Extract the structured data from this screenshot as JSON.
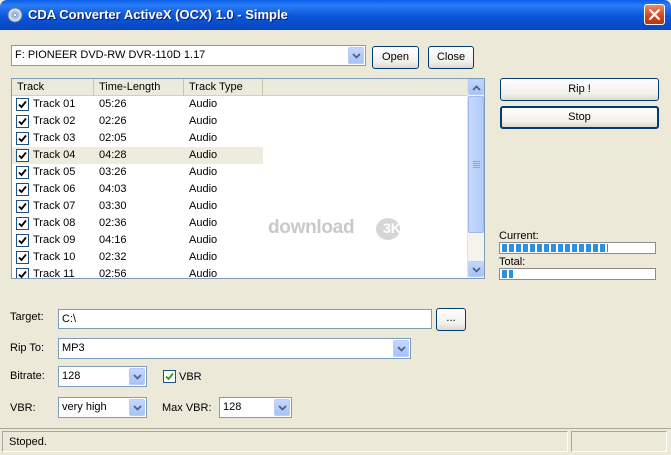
{
  "window": {
    "title": "CDA Converter ActiveX (OCX) 1.0 - Simple"
  },
  "drive": {
    "selected": "F: PIONEER  DVD-RW  DVR-110D 1.17"
  },
  "buttons": {
    "open": "Open",
    "close": "Close",
    "rip": "Rip !",
    "stop": "Stop",
    "browse": "..."
  },
  "tracklist": {
    "columns": [
      "Track",
      "Time-Length",
      "Track Type"
    ],
    "rows": [
      {
        "track": "Track 01",
        "time": "05:26",
        "type": "Audio"
      },
      {
        "track": "Track 02",
        "time": "02:26",
        "type": "Audio"
      },
      {
        "track": "Track 03",
        "time": "02:05",
        "type": "Audio"
      },
      {
        "track": "Track 04",
        "time": "04:28",
        "type": "Audio"
      },
      {
        "track": "Track 05",
        "time": "03:26",
        "type": "Audio"
      },
      {
        "track": "Track 06",
        "time": "04:03",
        "type": "Audio"
      },
      {
        "track": "Track 07",
        "time": "03:30",
        "type": "Audio"
      },
      {
        "track": "Track 08",
        "time": "02:36",
        "type": "Audio"
      },
      {
        "track": "Track 09",
        "time": "04:16",
        "type": "Audio"
      },
      {
        "track": "Track 10",
        "time": "02:32",
        "type": "Audio"
      },
      {
        "track": "Track 11",
        "time": "02:56",
        "type": "Audio"
      }
    ],
    "selected_index": 3
  },
  "progress": {
    "current_label": "Current:",
    "current": 0.7,
    "total_label": "Total:",
    "total": 0.07
  },
  "watermark": {
    "text": "download",
    "badge": "3K"
  },
  "form": {
    "target_label": "Target:",
    "target_value": "C:\\",
    "ripto_label": "Rip To:",
    "ripto_value": "MP3",
    "bitrate_label": "Bitrate:",
    "bitrate_value": "128",
    "vbr_check_label": "VBR",
    "vbr_checked": true,
    "vbr_label": "VBR:",
    "vbr_value": "very high",
    "maxvbr_label": "Max VBR:",
    "maxvbr_value": "128"
  },
  "status": {
    "text": "Stoped."
  },
  "icons": {
    "app": "disc-icon",
    "close": "close-icon",
    "dropdown": "chevron-down-icon",
    "check": "check-icon"
  }
}
